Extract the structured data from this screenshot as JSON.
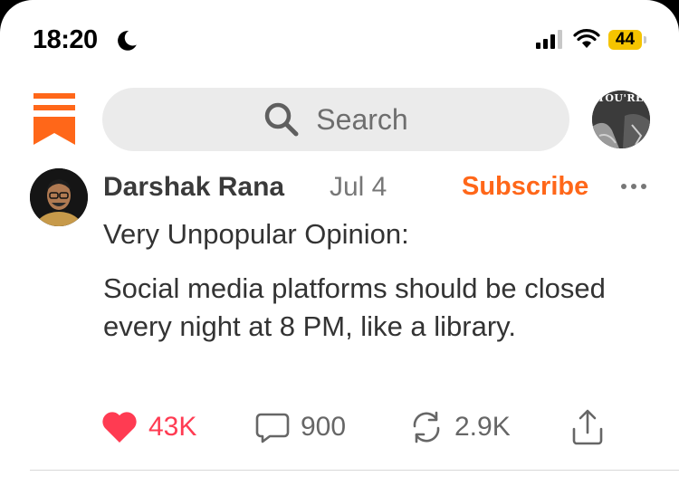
{
  "status_bar": {
    "time": "18:20",
    "battery": "44",
    "icons": [
      "moon-icon",
      "signal-icon",
      "wifi-icon",
      "battery-icon"
    ]
  },
  "header": {
    "search": {
      "placeholder": "Search"
    },
    "logo": "substack-logo",
    "profile_avatar_text": "YOU'RE"
  },
  "post": {
    "author": "Darshak Rana",
    "date": "Jul 4",
    "subscribe_label": "Subscribe",
    "body": [
      "Very Unpopular Opinion:",
      "Social media platforms should be closed every night at 8 PM, like a library."
    ],
    "actions": {
      "likes": "43K",
      "comments": "900",
      "restacks": "2.9K"
    }
  },
  "colors": {
    "accent": "#ff6719",
    "like": "#ff3b52",
    "search_bg": "#ebebeb",
    "battery": "#f5c400"
  }
}
